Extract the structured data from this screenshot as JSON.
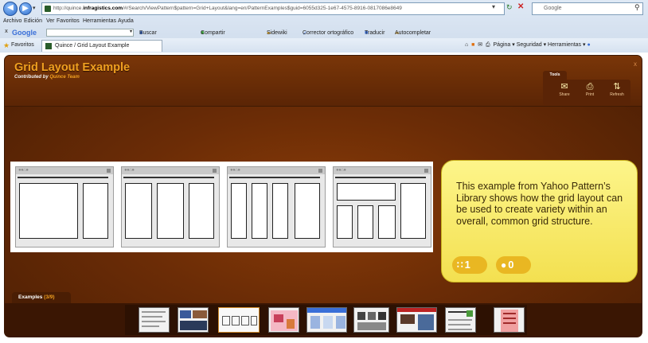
{
  "browser": {
    "url_prefix": "http://quince.",
    "url_domain": "infragistics.com",
    "url_rest": "/#/Search/ViewPattern$pattern=Grid+Layout&lang=en/PatternExamples$guid=6055d325-1e67-4575-8916-0817086e8649",
    "search_placeholder": "Google",
    "menu": [
      "Archivo",
      "Edición",
      "Ver",
      "Favoritos",
      "Herramientas",
      "Ayuda"
    ],
    "google_toolbar": {
      "logo": "Google",
      "items": [
        "Buscar",
        "Compartir",
        "Sidewiki",
        "Corrector ortográfico",
        "Traducir",
        "Autocompletar"
      ]
    },
    "favorites_label": "Favoritos",
    "tab_title": "Quince / Grid Layout Example",
    "command_items": [
      "Página",
      "Seguridad",
      "Herramientas"
    ]
  },
  "header": {
    "title": "Grid Layout Example",
    "contributed_by": "Contributed by",
    "team": "Quince Team",
    "close": "x"
  },
  "tools": {
    "tab_label": "Tools",
    "share": "Share",
    "print": "Print",
    "refresh": "Refresh"
  },
  "callout": {
    "text": "This example from Yahoo Pattern’s Library  shows how the grid layout can be used to create variety within an overall, common grid structure.",
    "rating_count": "1",
    "comment_count": "0"
  },
  "examples": {
    "label": "Examples",
    "count": "(3/9)",
    "selected_index": 2,
    "thumb_count": 9
  },
  "colors": {
    "accent": "#f0a020",
    "callout_bg": "#fdf58a",
    "pill": "#e9b722"
  }
}
